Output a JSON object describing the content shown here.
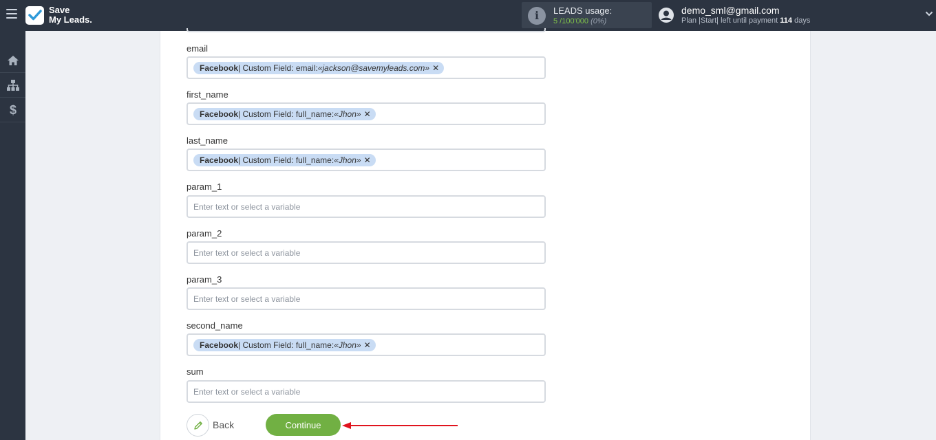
{
  "header": {
    "logo_line1": "Save",
    "logo_line2": "My Leads.",
    "usage_label": "LEADS usage:",
    "usage_count": "5 /100'000",
    "usage_pct": "(0%)",
    "user_email": "demo_sml@gmail.com",
    "plan_prefix": "Plan |Start| left until payment ",
    "plan_days": "114",
    "plan_suffix": " days"
  },
  "sidebar": {
    "icons": [
      "home-icon",
      "sitemap-icon",
      "dollar-icon"
    ]
  },
  "fields": [
    {
      "label": "email",
      "tag": {
        "source": "Facebook",
        "text": " | Custom Field: email: ",
        "value": "«jackson@savemyleads.com»"
      }
    },
    {
      "label": "first_name",
      "tag": {
        "source": "Facebook",
        "text": " | Custom Field: full_name: ",
        "value": "«Jhon»"
      }
    },
    {
      "label": "last_name",
      "tag": {
        "source": "Facebook",
        "text": " | Custom Field: full_name: ",
        "value": "«Jhon»"
      }
    },
    {
      "label": "param_1",
      "placeholder": "Enter text or select a variable"
    },
    {
      "label": "param_2",
      "placeholder": "Enter text or select a variable"
    },
    {
      "label": "param_3",
      "placeholder": "Enter text or select a variable"
    },
    {
      "label": "second_name",
      "tag": {
        "source": "Facebook",
        "text": " | Custom Field: full_name: ",
        "value": "«Jhon»"
      }
    },
    {
      "label": "sum",
      "placeholder": "Enter text or select a variable"
    }
  ],
  "actions": {
    "back_label": "Back",
    "continue_label": "Continue"
  },
  "colors": {
    "topbar": "#2c3441",
    "accent_green": "#71b043",
    "tag_bg": "#c9dcf4",
    "arrow_red": "#e0141e"
  }
}
